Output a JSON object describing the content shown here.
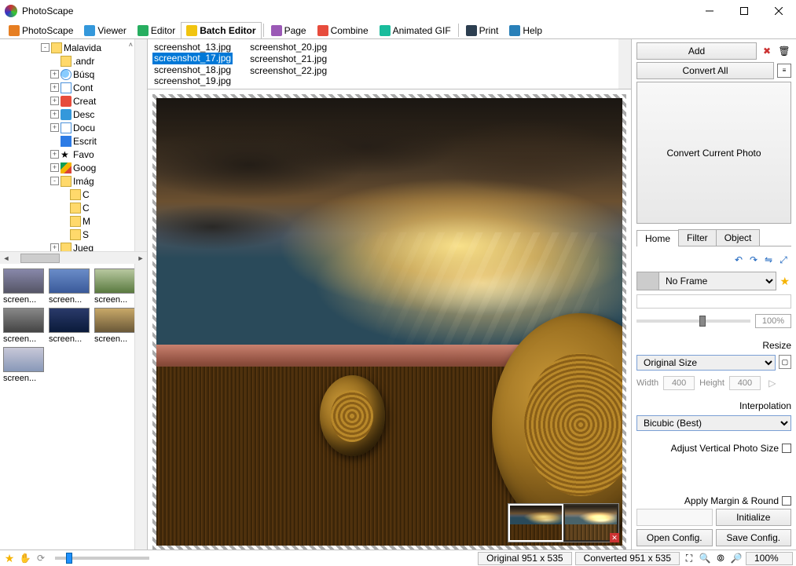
{
  "window": {
    "title": "PhotoScape"
  },
  "toolbar": [
    {
      "label": "PhotoScape",
      "icon": "#e67e22"
    },
    {
      "label": "Viewer",
      "icon": "#3498db"
    },
    {
      "label": "Editor",
      "icon": "#27ae60"
    },
    {
      "label": "Batch Editor",
      "icon": "#f1c40f",
      "active": true
    },
    {
      "label": "Page",
      "icon": "#9b59b6"
    },
    {
      "label": "Combine",
      "icon": "#e74c3c"
    },
    {
      "label": "Animated GIF",
      "icon": "#1abc9c"
    },
    {
      "label": "Print",
      "icon": "#2c3e50"
    },
    {
      "label": "Help",
      "icon": "#2980b9"
    }
  ],
  "tree": [
    {
      "indent": 4,
      "exp": "-",
      "icon": "ic-folder",
      "label": "Malavida"
    },
    {
      "indent": 5,
      "exp": "",
      "icon": "ic-folder",
      "label": ".andr"
    },
    {
      "indent": 5,
      "exp": "+",
      "icon": "ic-search",
      "label": "Búsq"
    },
    {
      "indent": 5,
      "exp": "+",
      "icon": "ic-contact",
      "label": "Cont"
    },
    {
      "indent": 5,
      "exp": "+",
      "icon": "ic-trash",
      "label": "Creat"
    },
    {
      "indent": 5,
      "exp": "+",
      "icon": "ic-down",
      "label": "Desc"
    },
    {
      "indent": 5,
      "exp": "+",
      "icon": "ic-doc",
      "label": "Docu"
    },
    {
      "indent": 5,
      "exp": "",
      "icon": "ic-book",
      "label": "Escrit"
    },
    {
      "indent": 5,
      "exp": "+",
      "icon": "ic-star",
      "label": "Favo",
      "glyph": "★"
    },
    {
      "indent": 5,
      "exp": "+",
      "icon": "ic-drive",
      "label": "Goog"
    },
    {
      "indent": 5,
      "exp": "-",
      "icon": "ic-folder",
      "label": "Imág"
    },
    {
      "indent": 6,
      "exp": "",
      "icon": "ic-folder",
      "label": "C"
    },
    {
      "indent": 6,
      "exp": "",
      "icon": "ic-folder",
      "label": "C"
    },
    {
      "indent": 6,
      "exp": "",
      "icon": "ic-folder",
      "label": "M"
    },
    {
      "indent": 6,
      "exp": "",
      "icon": "ic-folder",
      "label": "S"
    },
    {
      "indent": 5,
      "exp": "+",
      "icon": "ic-folder",
      "label": "Jueg"
    }
  ],
  "thumbs": [
    {
      "label": "screen...",
      "bg": "linear-gradient(#88a,#556)"
    },
    {
      "label": "screen...",
      "bg": "linear-gradient(#6a8cc8,#3a5a9a)"
    },
    {
      "label": "screen...",
      "bg": "linear-gradient(#b8c8a0,#5a7a40)"
    },
    {
      "label": "screen...",
      "bg": "linear-gradient(#888,#444)"
    },
    {
      "label": "screen...",
      "bg": "linear-gradient(#2a3a6a,#0a1a3a)"
    },
    {
      "label": "screen...",
      "bg": "linear-gradient(#c8a868,#6a5838)"
    },
    {
      "label": "screen...",
      "bg": "linear-gradient(#c8c8d8,#8898b8)"
    }
  ],
  "files": {
    "col1": [
      "screenshot_13.jpg",
      "screenshot_17.jpg",
      "screenshot_18.jpg",
      "screenshot_19.jpg"
    ],
    "col2": [
      "screenshot_20.jpg",
      "screenshot_21.jpg",
      "screenshot_22.jpg"
    ],
    "selected": "screenshot_17.jpg"
  },
  "right": {
    "add": "Add",
    "convert_all": "Convert All",
    "convert_current": "Convert Current Photo",
    "tabs": [
      "Home",
      "Filter",
      "Object"
    ],
    "active_tab": "Home",
    "frame": "No Frame",
    "slider_pct": "100%",
    "resize_title": "Resize",
    "resize_mode": "Original Size",
    "width_label": "Width",
    "height_label": "Height",
    "width": "400",
    "height": "400",
    "interp_title": "Interpolation",
    "interp": "Bicubic (Best)",
    "adjust_vertical": "Adjust Vertical Photo Size",
    "margin_round": "Apply Margin & Round",
    "initialize": "Initialize",
    "open_config": "Open Config.",
    "save_config": "Save Config."
  },
  "status": {
    "original": "Original 951 x 535",
    "converted": "Converted 951 x 535",
    "zoom": "100%"
  }
}
